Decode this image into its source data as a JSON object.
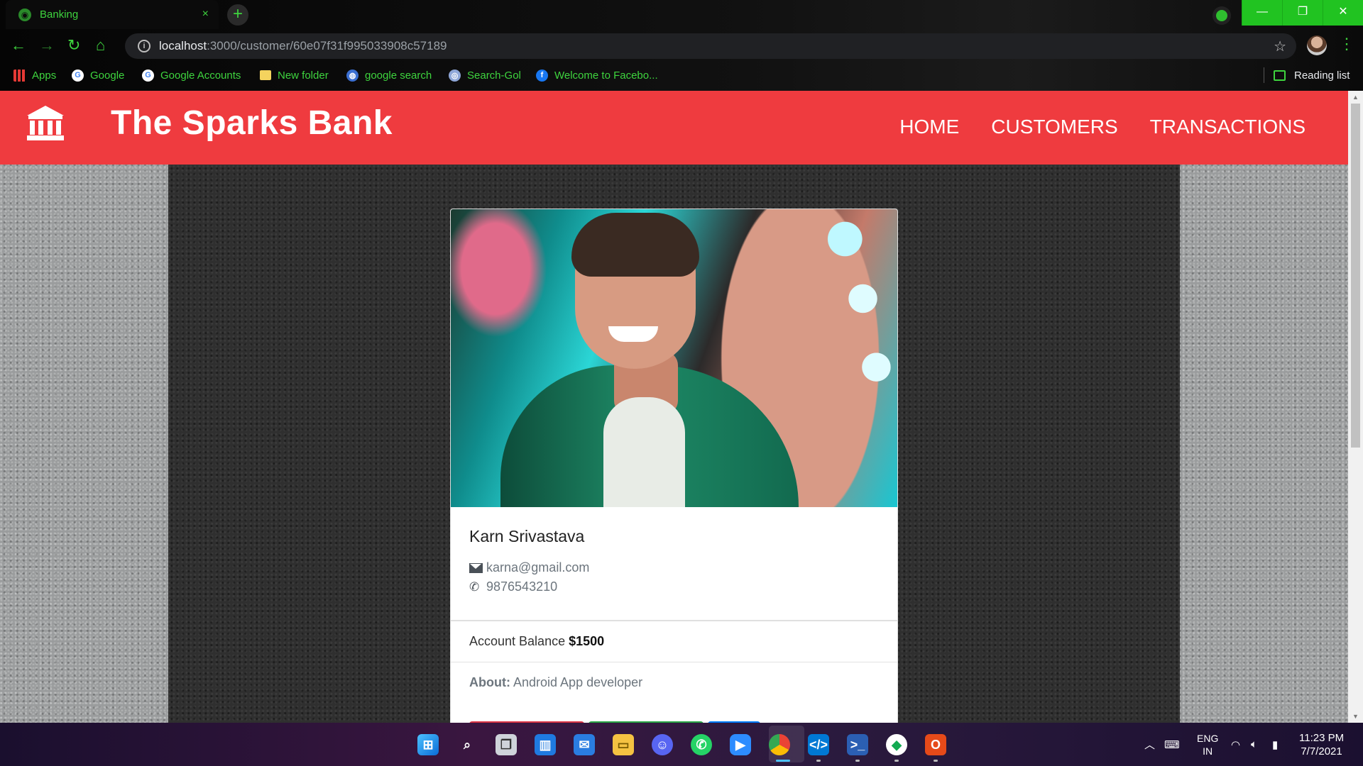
{
  "browser": {
    "tab_title": "Banking",
    "tab_close": "×",
    "new_tab": "+",
    "url_host": "localhost",
    "url_path": ":3000/customer/60e07f31f995033908c57189",
    "info_glyph": "i",
    "window_controls": [
      "—",
      "❐",
      "✕"
    ],
    "bookmarks": [
      "Apps",
      "Google",
      "Google Accounts",
      "New folder",
      "google search",
      "Search-Gol",
      "Welcome to Facebo..."
    ],
    "reading_list": "Reading list"
  },
  "navbar": {
    "brand": "The Sparks Bank",
    "links": [
      "HOME",
      "CUSTOMERS",
      "TRANSACTIONS"
    ]
  },
  "customer": {
    "name": "Karn Srivastava",
    "email": "karna@gmail.com",
    "phone": "9876543210",
    "balance_label": "Account Balance",
    "balance_value": "$1500",
    "about_label": "About:",
    "about_value": "Android App developer"
  },
  "card_buttons": [
    {
      "color": "#dc3545"
    },
    {
      "color": "#28a745"
    },
    {
      "color": "#007bff"
    }
  ],
  "taskbar": {
    "apps": [
      "start",
      "search",
      "task-view",
      "widgets",
      "mail",
      "file-explorer",
      "discord",
      "whatsapp",
      "zoom",
      "chrome",
      "vscode",
      "powershell",
      "mongodb-compass",
      "office"
    ],
    "language_line1": "ENG",
    "language_line2": "IN",
    "time": "11:23 PM",
    "date": "7/7/2021"
  },
  "colors": {
    "accent_green": "#3ed43e",
    "navbar_red": "#ef3b3f"
  }
}
